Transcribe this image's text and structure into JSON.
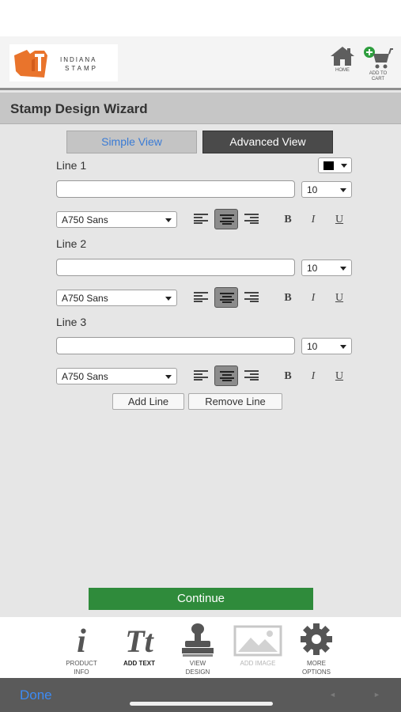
{
  "header": {
    "logo_text_line1": "INDIANA",
    "logo_text_line2": "STAMP",
    "home_label": "HOME",
    "cart_label_line1": "ADD TO",
    "cart_label_line2": "CART"
  },
  "title": "Stamp Design Wizard",
  "view_tabs": {
    "simple": "Simple View",
    "advanced": "Advanced View",
    "selected": "Simple View"
  },
  "text_color": "#000000",
  "lines": [
    {
      "label": "Line 1",
      "value": "",
      "size": "10",
      "font": "A750 Sans",
      "alignment": "center"
    },
    {
      "label": "Line 2",
      "value": "",
      "size": "10",
      "font": "A750 Sans",
      "alignment": "center"
    },
    {
      "label": "Line 3",
      "value": "",
      "size": "10",
      "font": "A750 Sans",
      "alignment": "center"
    }
  ],
  "format_buttons": {
    "bold": "B",
    "italic": "I",
    "underline": "U"
  },
  "buttons": {
    "add_line": "Add Line",
    "remove_line": "Remove Line",
    "continue": "Continue"
  },
  "colors": {
    "continue_bg": "#2f8b3b",
    "accent_blue": "#3d8bf5",
    "cart_plus": "#2e9e3e"
  },
  "tabbar": [
    {
      "icon": "info-i-icon",
      "label_line1": "PRODUCT",
      "label_line2": "INFO",
      "state": "normal"
    },
    {
      "icon": "text-tt-icon",
      "label_line1": "ADD TEXT",
      "label_line2": "",
      "state": "active"
    },
    {
      "icon": "stamp-icon",
      "label_line1": "VIEW",
      "label_line2": "DESIGN",
      "state": "normal"
    },
    {
      "icon": "image-icon",
      "label_line1": "ADD IMAGE",
      "label_line2": "",
      "state": "disabled"
    },
    {
      "icon": "gear-icon",
      "label_line1": "MORE",
      "label_line2": "OPTIONS",
      "state": "normal"
    }
  ],
  "bottom": {
    "done": "Done",
    "prev_arrow": "◄",
    "next_arrow": "►"
  }
}
